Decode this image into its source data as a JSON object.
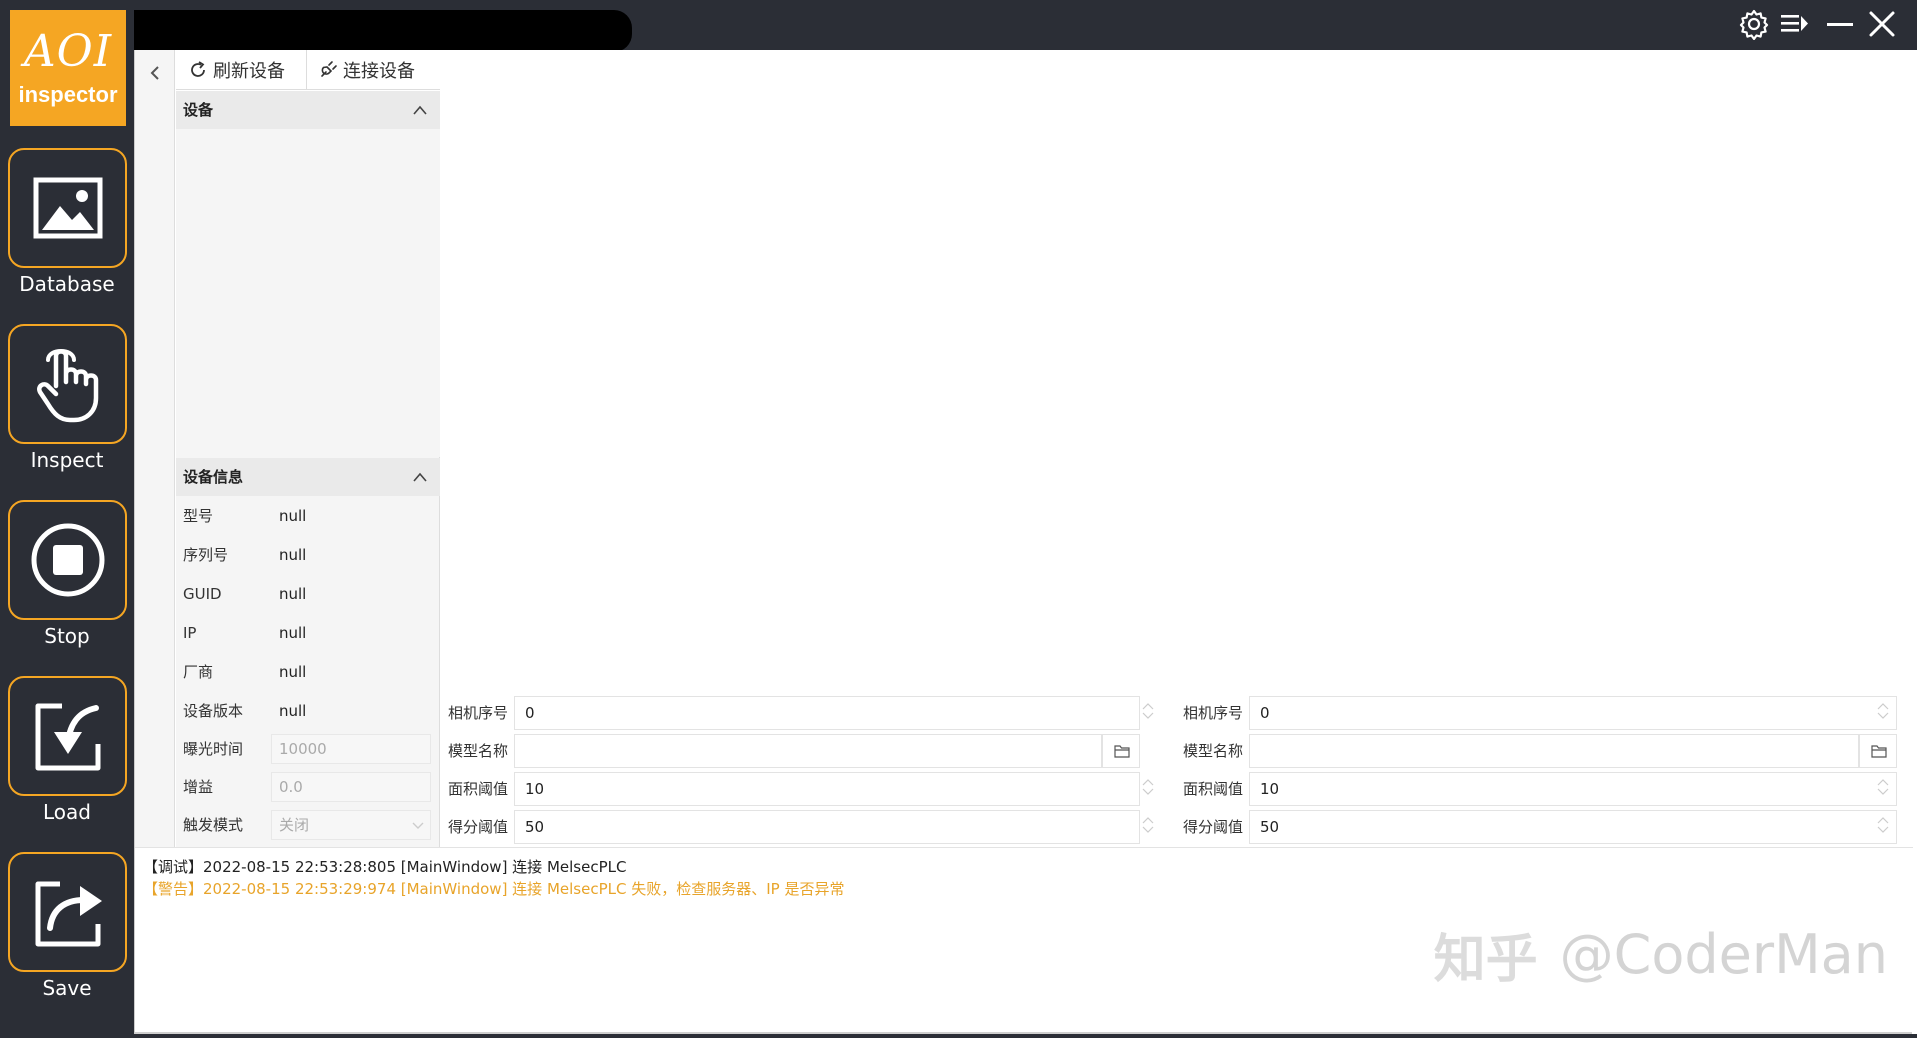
{
  "logo": {
    "line1": "AOI",
    "line2": "inspector"
  },
  "nav": [
    {
      "label": "Database",
      "icon": "image-icon"
    },
    {
      "label": "Inspect",
      "icon": "hand-pointer-icon"
    },
    {
      "label": "Stop",
      "icon": "stop-icon"
    },
    {
      "label": "Load",
      "icon": "load-icon"
    },
    {
      "label": "Save",
      "icon": "share-icon"
    }
  ],
  "titlebar": {
    "icons": [
      "gear-icon",
      "queue-icon",
      "minimize-icon",
      "close-icon"
    ]
  },
  "toolbar": {
    "refresh_label": "刷新设备",
    "connect_label": "连接设备"
  },
  "devices_section": {
    "title": "设备"
  },
  "device_info": {
    "title": "设备信息",
    "rows": [
      {
        "key": "型号",
        "value": "null"
      },
      {
        "key": "序列号",
        "value": "null"
      },
      {
        "key": "GUID",
        "value": "null"
      },
      {
        "key": "IP",
        "value": "null"
      },
      {
        "key": "厂商",
        "value": "null"
      },
      {
        "key": "设备版本",
        "value": "null"
      },
      {
        "key": "曝光时间",
        "value": "10000"
      },
      {
        "key": "增益",
        "value": "0.0"
      },
      {
        "key": "触发模式",
        "value": "关闭"
      }
    ]
  },
  "params_left": {
    "camera_index_label": "相机序号",
    "camera_index": "0",
    "model_name_label": "模型名称",
    "model_name": "",
    "area_threshold_label": "面积阈值",
    "area_threshold": "10",
    "score_threshold_label": "得分阈值",
    "score_threshold": "50"
  },
  "params_right": {
    "camera_index_label": "相机序号",
    "camera_index": "0",
    "model_name_label": "模型名称",
    "model_name": "",
    "area_threshold_label": "面积阈值",
    "area_threshold": "10",
    "score_threshold_label": "得分阈值",
    "score_threshold": "50"
  },
  "log": {
    "line1": "【调试】2022-08-15 22:53:28:805 [MainWindow] 连接 MelsecPLC",
    "line2": "【警告】2022-08-15 22:53:29:974 [MainWindow] 连接 MelsecPLC 失败，检查服务器、IP 是否异常"
  },
  "watermark": {
    "cn": "知乎",
    "handle": "@CoderMan"
  },
  "colors": {
    "accent": "#f5a623",
    "sidebar": "#2b2e36",
    "warn": "#e8a42a"
  }
}
